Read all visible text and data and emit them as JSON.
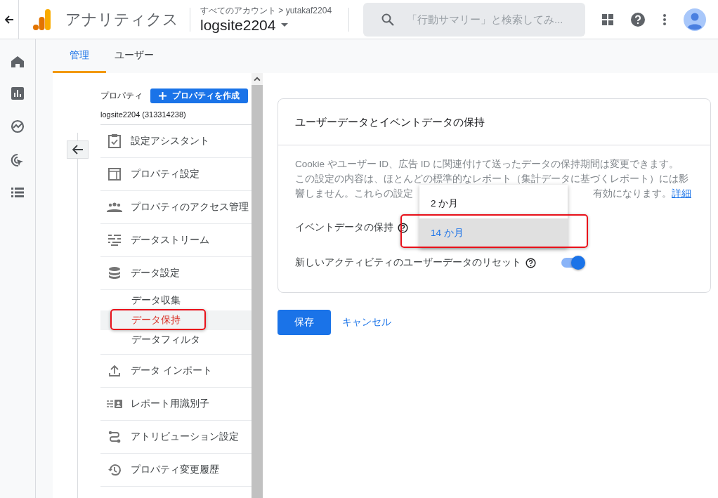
{
  "header": {
    "app_name": "アナリティクス",
    "breadcrumb": "すべてのアカウント > yutakaf2204",
    "property": "logsite2204",
    "search": {
      "placeholder": "「行動サマリー」と検索してみ..."
    }
  },
  "tabs": [
    {
      "label": "管理",
      "selected": true
    },
    {
      "label": "ユーザー",
      "selected": false
    }
  ],
  "property_panel": {
    "label": "プロパティ",
    "create_button": "プロパティを作成",
    "property_name": "logsite2204 (313314238)",
    "items": [
      {
        "label": "設定アシスタント"
      },
      {
        "label": "プロパティ設定"
      },
      {
        "label": "プロパティのアクセス管理"
      },
      {
        "label": "データストリーム"
      },
      {
        "label": "データ設定",
        "children": [
          {
            "label": "データ収集",
            "selected": false
          },
          {
            "label": "データ保持",
            "selected": true
          },
          {
            "label": "データフィルタ",
            "selected": false
          }
        ]
      },
      {
        "label": "データ インポート"
      },
      {
        "label": "レポート用識別子"
      },
      {
        "label": "アトリビューション設定"
      },
      {
        "label": "プロパティ変更履歴"
      }
    ]
  },
  "card": {
    "title": "ユーザーデータとイベントデータの保持",
    "description_lines": [
      "Cookie やユーザー ID、広告 ID に関連付けて送ったデータの保持期間は変更できます。",
      "この設定の内容は、ほとんどの標準的なレポート（集計データに基づくレポート）には影"
    ],
    "description_last": [
      "響しません。これらの設定",
      "有効になります。"
    ],
    "link": "詳細",
    "event_retention_label": "イベントデータの保持",
    "reset_label": "新しいアクティビティのユーザーデータのリセット",
    "reset_on": true,
    "dropdown": [
      {
        "label": "2 か月",
        "selected": false
      },
      {
        "label": "14 か月",
        "selected": true
      }
    ]
  },
  "buttons": {
    "save": "保存",
    "cancel": "キャンセル"
  }
}
